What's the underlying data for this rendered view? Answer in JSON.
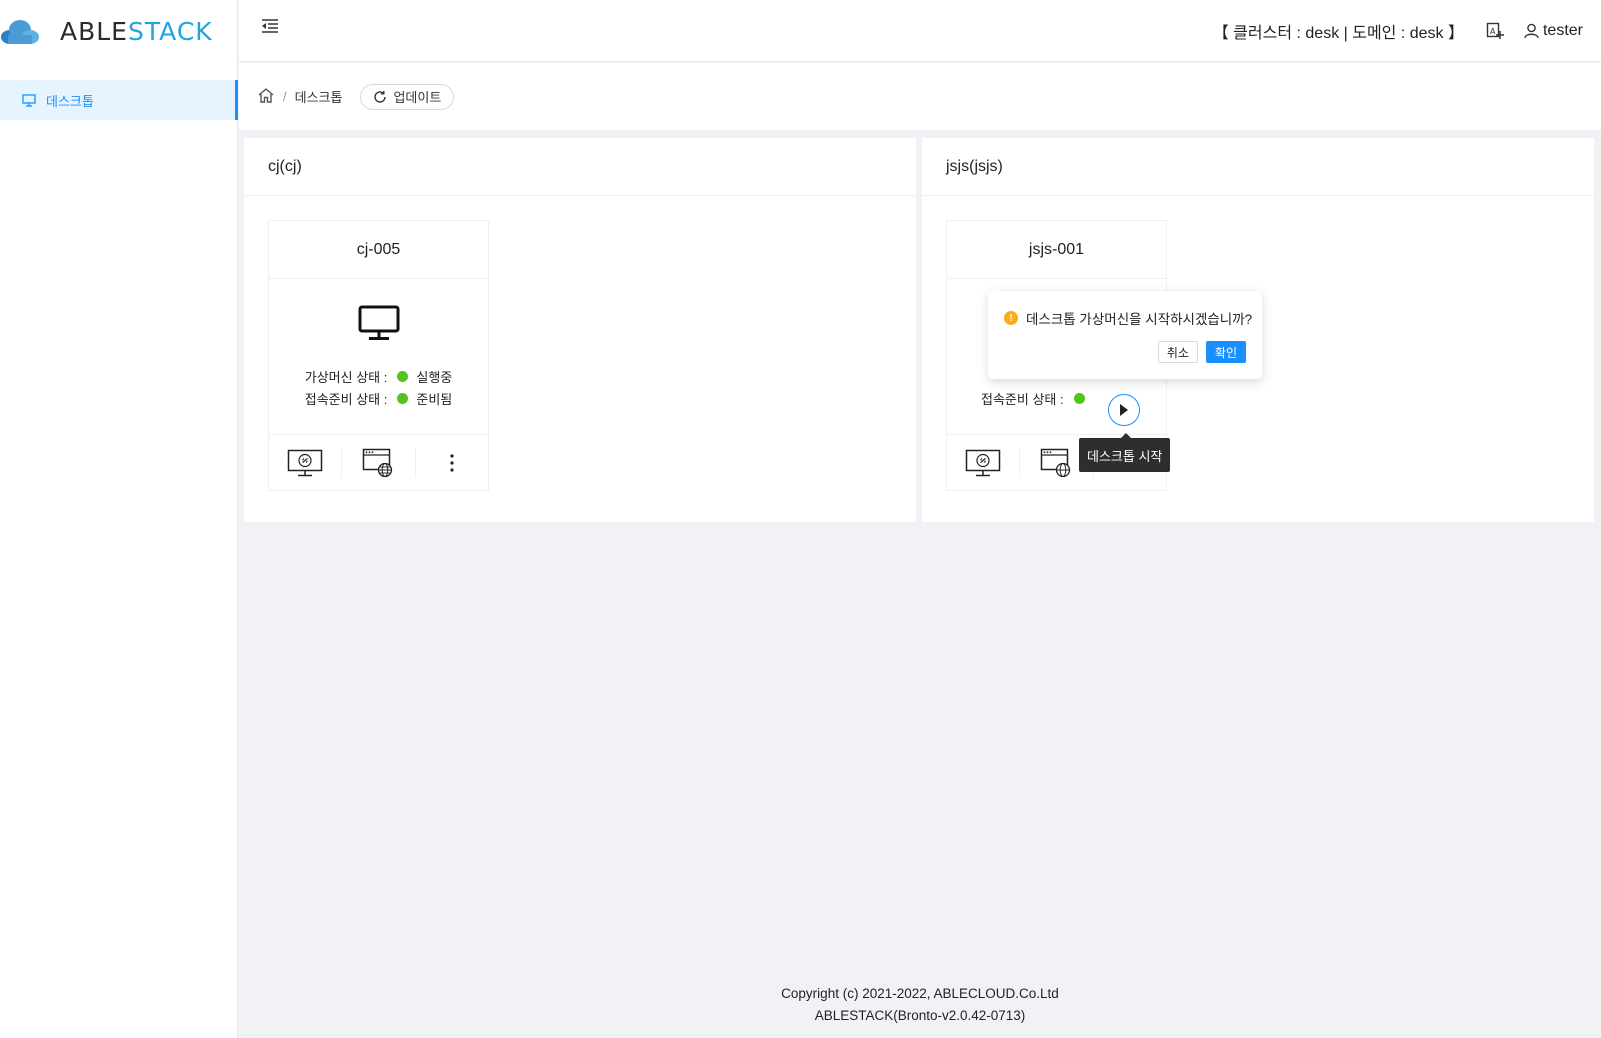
{
  "app": {
    "logo_able": "ABLE",
    "logo_stack": "STACK",
    "logo_icon": "cloud-icon"
  },
  "sidebar": {
    "items": [
      {
        "label": "데스크톱",
        "icon": "desktop-icon",
        "active": true
      }
    ]
  },
  "header": {
    "cluster_info": "【 클러스터 : desk  |  도메인 : desk 】",
    "username": "tester"
  },
  "breadcrumb": {
    "home_icon": "home-icon",
    "separator": "/",
    "current": "데스크톱",
    "refresh_label": "업데이트"
  },
  "panels": [
    {
      "title": "cj(cj)",
      "card": {
        "name": "cj-005",
        "vm_status_label": "가상머신 상태 :",
        "vm_status_value": "실행중",
        "vm_status_color": "#52c41a",
        "conn_status_label": "접속준비 상태 :",
        "conn_status_value": "준비됨",
        "conn_status_color": "#52c41a"
      }
    },
    {
      "title": "jsjs(jsjs)",
      "card": {
        "name": "jsjs-001",
        "conn_status_label": "접속준비 상태 :",
        "conn_status_color": "#52c41a"
      }
    }
  ],
  "popconfirm": {
    "message": "데스크톱 가상머신을 시작하시겠습니까?",
    "cancel_label": "취소",
    "ok_label": "확인",
    "icon": "warning-icon"
  },
  "tooltip": {
    "text": "데스크톱 시작"
  },
  "footer": {
    "copyright": "Copyright (c) 2021-2022, ABLECLOUD.Co.Ltd",
    "version": "ABLESTACK(Bronto-v2.0.42-0713)"
  },
  "colors": {
    "accent": "#1890ff",
    "brand_stack": "#1fa4e0",
    "status_green": "#52c41a",
    "status_red": "#ff4d4f",
    "warning": "#faad14"
  }
}
